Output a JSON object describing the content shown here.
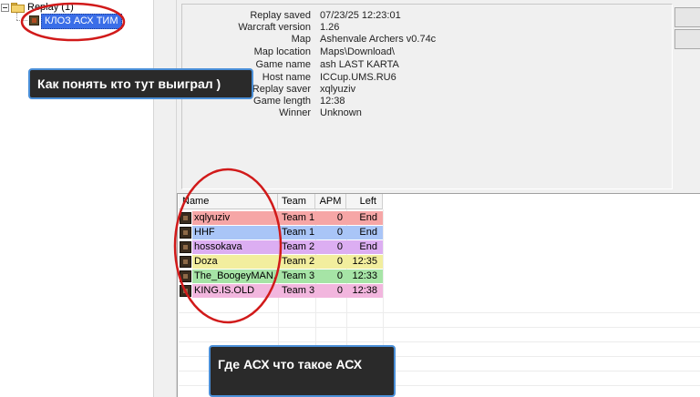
{
  "tree": {
    "root_label": "Replay (1)",
    "selected_item": "КЛОЗ АСХ ТИМ"
  },
  "info": {
    "rows": [
      {
        "label": "Replay saved",
        "value": "07/23/25 12:23:01"
      },
      {
        "label": "Warcraft version",
        "value": "1.26"
      },
      {
        "label": "Map",
        "value": "Ashenvale Archers v0.74c"
      },
      {
        "label": "Map location",
        "value": "Maps\\Download\\"
      },
      {
        "label": "Game name",
        "value": "ash LAST KARTA"
      },
      {
        "label": "Host name",
        "value": "ICCup.UMS.RU6"
      },
      {
        "label": "Replay saver",
        "value": "xqlyuziv"
      },
      {
        "label": "Game length",
        "value": "12:38"
      },
      {
        "label": "Winner",
        "value": "Unknown"
      }
    ]
  },
  "players": {
    "headers": {
      "name": "Name",
      "team": "Team",
      "apm": "APM",
      "left": "Left"
    },
    "rows": [
      {
        "name": "xqlyuziv",
        "team": "Team 1",
        "apm": "0",
        "left": "End",
        "color": "#f6a6a6"
      },
      {
        "name": "HHF",
        "team": "Team 1",
        "apm": "0",
        "left": "End",
        "color": "#a9c5f7"
      },
      {
        "name": "hossokava",
        "team": "Team 2",
        "apm": "0",
        "left": "End",
        "color": "#dcaef2"
      },
      {
        "name": "Doza",
        "team": "Team 2",
        "apm": "0",
        "left": "12:35",
        "color": "#f2ee9e"
      },
      {
        "name": "The_BoogeyMAN.",
        "team": "Team 3",
        "apm": "0",
        "left": "12:33",
        "color": "#a6e4a6"
      },
      {
        "name": "KING.IS.OLD",
        "team": "Team 3",
        "apm": "0",
        "left": "12:38",
        "color": "#f2b6de"
      }
    ]
  },
  "annotations": {
    "callout_top": "Как понять кто тут выиграл )",
    "callout_bottom": "Где АСХ что такое АСХ",
    "circle_color": "#d11a1a",
    "callout_border_color": "#4a8fd8"
  }
}
